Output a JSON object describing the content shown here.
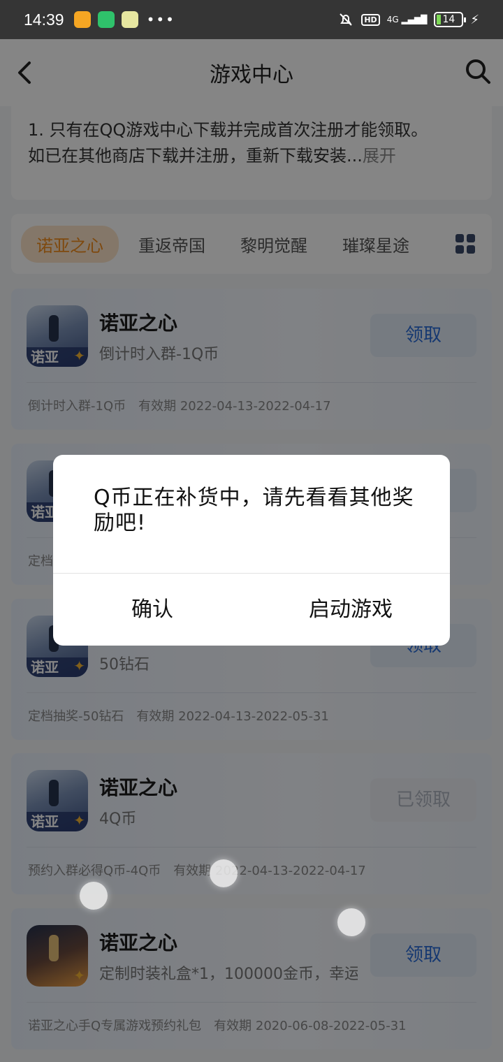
{
  "status_bar": {
    "time": "14:39",
    "dots": "•••",
    "network": "4G",
    "hd": "HD",
    "battery": "14",
    "bolt": "⚡"
  },
  "nav": {
    "title": "游戏中心"
  },
  "rules": {
    "line1": "1. 只有在QQ游戏中心下载并完成首次注册才能领取。",
    "line2": "如已在其他商店下载并注册，重新下载安装...",
    "more": "展开"
  },
  "tabs": [
    {
      "label": "诺亚之心",
      "active": true
    },
    {
      "label": "重返帝国",
      "active": false
    },
    {
      "label": "黎明觉醒",
      "active": false
    },
    {
      "label": "璀璨星途",
      "active": false
    }
  ],
  "cards": [
    {
      "name": "诺亚之心",
      "sub": "倒计时入群-1Q币",
      "button": "领取",
      "foot_desc": "倒计时入群-1Q币",
      "foot_validity": "有效期 2022-04-13-2022-04-17",
      "icon_text": "诺亚"
    },
    {
      "name": "",
      "sub": "",
      "button": "",
      "foot_desc": "定档",
      "foot_validity": "",
      "icon_text": "诺亚"
    },
    {
      "name": "",
      "sub": "50钻石",
      "button": "领取",
      "foot_desc": "定档抽奖-50钻石",
      "foot_validity": "有效期 2022-04-13-2022-05-31",
      "icon_text": "诺亚"
    },
    {
      "name": "诺亚之心",
      "sub": "4Q币",
      "button": "已领取",
      "foot_desc": "预约入群必得Q币-4Q币",
      "foot_validity": "有效期 2022-04-13-2022-04-17",
      "icon_text": "诺亚"
    },
    {
      "name": "诺亚之心",
      "sub": "定制时装礼盒*1，100000金币，幸运",
      "button": "领取",
      "foot_desc": "诺亚之心手Q专属游戏预约礼包",
      "foot_validity": "有效期 2020-06-08-2022-05-31",
      "icon_text": ""
    }
  ],
  "dialog": {
    "message": "Q币正在补货中，请先看看其他奖励吧!",
    "confirm": "确认",
    "launch": "启动游戏"
  },
  "colors": {
    "accent_orange": "#f28c1c",
    "link_blue": "#2a6bd8",
    "overlay": "rgba(0,0,0,0.48)"
  }
}
